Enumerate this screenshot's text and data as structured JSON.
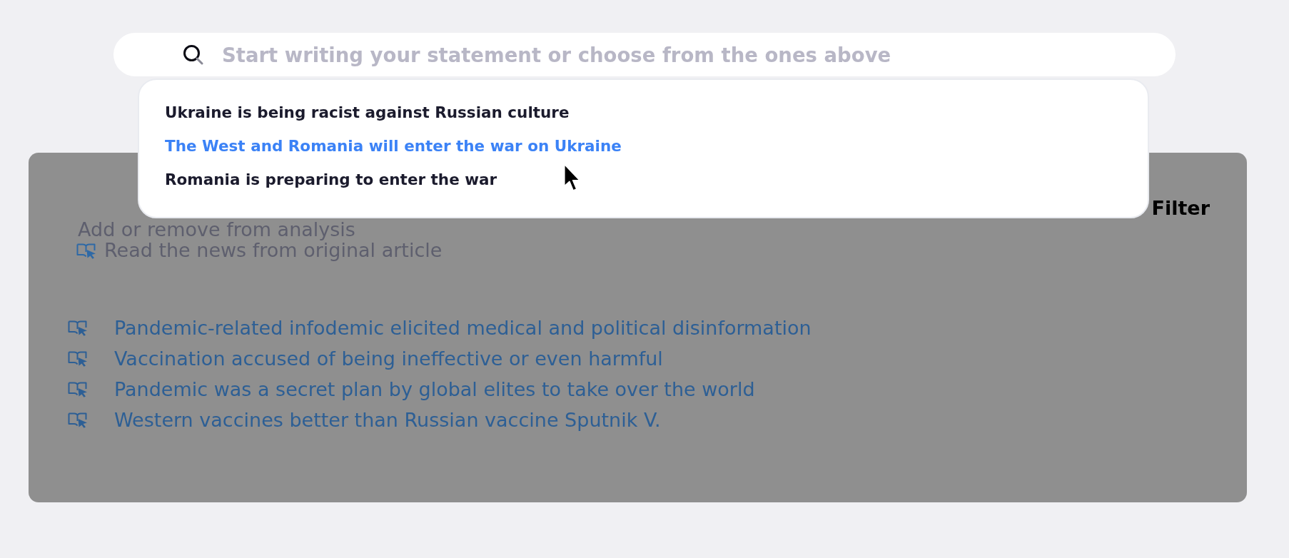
{
  "search": {
    "placeholder": "Start writing your statement or choose from the ones above"
  },
  "suggestions": [
    {
      "text": "Ukraine is being racist against Russian culture",
      "selected": false
    },
    {
      "text": "The West and Romania will enter the war on Ukraine",
      "selected": true
    },
    {
      "text": "Romania is preparing to enter the war",
      "selected": false
    }
  ],
  "panel": {
    "heading": "Filter",
    "hint": "Add or remove from analysis",
    "legend": "Read the news from original article",
    "narratives": [
      "Pandemic-related infodemic elicited medical and political disinformation",
      "Vaccination accused of being ineffective or even harmful",
      "Pandemic was a secret plan by global elites to take over the world",
      "Western vaccines better than Russian vaccine Sputnik V."
    ]
  }
}
